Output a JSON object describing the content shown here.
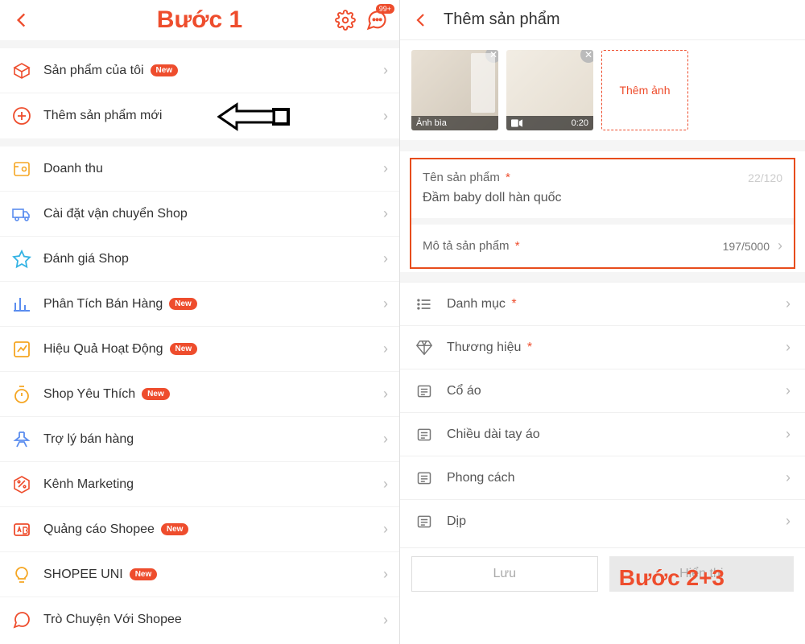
{
  "left": {
    "step_label": "Bước 1",
    "chat_badge": "99+",
    "group1": [
      {
        "icon": "box",
        "label": "Sản phẩm của tôi",
        "badge": "New"
      },
      {
        "icon": "plus",
        "label": "Thêm sản phẩm mới",
        "badge": null,
        "arrow": true
      }
    ],
    "group2": [
      {
        "icon": "revenue",
        "label": "Doanh thu",
        "badge": null
      },
      {
        "icon": "truck",
        "label": "Cài đặt vận chuyển Shop",
        "badge": null
      },
      {
        "icon": "star",
        "label": "Đánh giá Shop",
        "badge": null
      },
      {
        "icon": "bars",
        "label": "Phân Tích Bán Hàng",
        "badge": "New"
      },
      {
        "icon": "perf",
        "label": "Hiệu Quả Hoạt Động",
        "badge": "New"
      },
      {
        "icon": "timer",
        "label": "Shop Yêu Thích",
        "badge": "New"
      },
      {
        "icon": "assist",
        "label": "Trợ lý bán hàng",
        "badge": null
      },
      {
        "icon": "percent",
        "label": "Kênh Marketing",
        "badge": null
      },
      {
        "icon": "ad",
        "label": "Quảng cáo Shopee",
        "badge": "New"
      },
      {
        "icon": "bulb",
        "label": "SHOPEE UNI",
        "badge": "New"
      },
      {
        "icon": "chat",
        "label": "Trò Chuyện Với Shopee",
        "badge": null
      }
    ]
  },
  "right": {
    "title": "Thêm sản phẩm",
    "cover_label": "Ảnh bìa",
    "video_time": "0:20",
    "add_photo": "Thêm ảnh",
    "name_label": "Tên sản phẩm",
    "name_counter": "22/120",
    "name_value": "Đầm baby doll hàn quốc",
    "desc_label": "Mô tả sản phẩm",
    "desc_counter": "197/5000",
    "attrs": [
      {
        "icon": "list",
        "label": "Danh mục",
        "req": true
      },
      {
        "icon": "diamond",
        "label": "Thương hiệu",
        "req": true
      },
      {
        "icon": "note",
        "label": "Cổ áo",
        "req": false
      },
      {
        "icon": "note",
        "label": "Chiều dài tay áo",
        "req": false
      },
      {
        "icon": "note",
        "label": "Phong cách",
        "req": false
      },
      {
        "icon": "note",
        "label": "Dịp",
        "req": false
      }
    ],
    "step_label": "Bước 2+3",
    "btn_save": "Lưu",
    "btn_show": "Hiển thị"
  }
}
